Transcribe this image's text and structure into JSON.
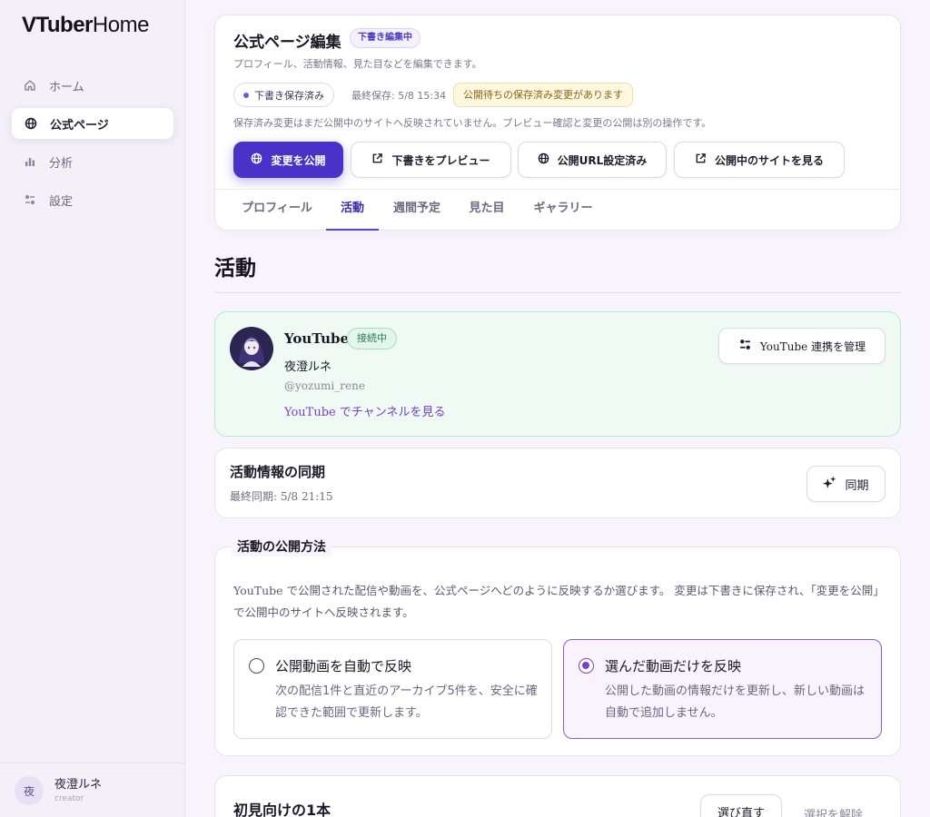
{
  "app": {
    "brand_bold": "VTuber",
    "brand_light": "Home"
  },
  "sidebar": {
    "items": [
      {
        "label": "ホーム",
        "icon": "home-icon",
        "active": false
      },
      {
        "label": "公式ページ",
        "icon": "globe-icon",
        "active": true
      },
      {
        "label": "分析",
        "icon": "bar-chart-icon",
        "active": false
      },
      {
        "label": "設定",
        "icon": "sliders-icon",
        "active": false
      }
    ],
    "user": {
      "initial": "夜",
      "name": "夜澄ルネ",
      "role": "creator"
    }
  },
  "header": {
    "title": "公式ページ編集",
    "badge": "下書き編集中",
    "subtitle": "プロフィール、活動情報、見た目などを編集できます。",
    "saved_pill": "下書き保存済み",
    "last_saved": "最終保存: 5/8 15:34",
    "warning": "公開待ちの保存済み変更があります",
    "note": "保存済み変更はまだ公開中のサイトへ反映されていません。プレビュー確認と変更の公開は別の操作です。",
    "buttons": {
      "publish": "変更を公開",
      "preview": "下書きをプレビュー",
      "url": "公開URL設定済み",
      "view_site": "公開中のサイトを見る"
    },
    "tabs": [
      "プロフィール",
      "活動",
      "週間予定",
      "見た目",
      "ギャラリー"
    ],
    "active_tab": "活動"
  },
  "main": {
    "section_title": "活動",
    "youtube": {
      "service": "YouTube",
      "status": "接続中",
      "channel_name": "夜澄ルネ",
      "handle": "@yozumi_rene",
      "link": "YouTube でチャンネルを見る",
      "manage_button": "YouTube 連携を管理"
    },
    "sync": {
      "title": "活動情報の同期",
      "last_sync": "最終同期: 5/8 21:15",
      "button": "同期"
    },
    "publish_method": {
      "legend": "活動の公開方法",
      "description": "YouTube で公開された配信や動画を、公式ページへどのように反映するか選びます。 変更は下書きに保存され、「変更を公開」で公開中のサイトへ反映されます。",
      "options": [
        {
          "title": "公開動画を自動で反映",
          "desc": "次の配信1件と直近のアーカイブ5件を、安全に確認できた範囲で更新します。",
          "selected": false
        },
        {
          "title": "選んだ動画だけを反映",
          "desc": "公開した動画の情報だけを更新し、新しい動画は自動で追加しません。",
          "selected": true
        }
      ]
    },
    "first_video": {
      "title": "初見向けの1本",
      "rechoose_button": "選び直す",
      "clear_button": "選択を解除"
    }
  },
  "colors": {
    "accent": "#4a32c8",
    "selected_option": "#7b3fd0",
    "connected_bg": "#effaf5",
    "warning_bg": "#fff7df"
  }
}
